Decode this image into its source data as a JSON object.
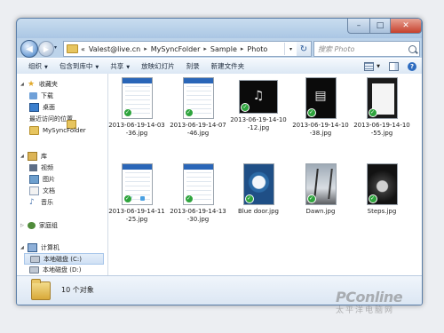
{
  "window": {
    "controls": {
      "min": "–",
      "max": "□",
      "close": "✕"
    }
  },
  "address": {
    "recent_arrow": "▾",
    "lead": "«",
    "crumbs": [
      "Valest@live.cn",
      "MySyncFolder",
      "Sample",
      "Photo"
    ],
    "separator": "▸",
    "dropdown": "▾",
    "refresh": "↻"
  },
  "search": {
    "placeholder": "搜索 Photo"
  },
  "toolbar": {
    "organize": "组织",
    "include": "包含到库中",
    "share": "共享",
    "slideshow": "放映幻灯片",
    "burn": "刻录",
    "new_folder": "新建文件夹",
    "help": "?"
  },
  "sidebar": {
    "favorites": "收藏夹",
    "downloads": "下载",
    "desktop": "桌面",
    "recent": "最近访问的位置",
    "mysync": "MySyncFolder",
    "libraries": "库",
    "videos": "视频",
    "pictures": "图片",
    "documents": "文档",
    "music": "音乐",
    "homegroup": "家庭组",
    "computer": "计算机",
    "drive_c": "本地磁盘 (C:)",
    "drive_d": "本地磁盘 (D:)"
  },
  "files": [
    "2013-06-19-14-03-36.jpg",
    "2013-06-19-14-07-46.jpg",
    "2013-06-19-14-10-12.jpg",
    "2013-06-19-14-10-38.jpg",
    "2013-06-19-14-10-55.jpg",
    "2013-06-19-14-11-25.jpg",
    "2013-06-19-14-13-30.jpg",
    "Blue door.jpg",
    "Dawn.jpg",
    "Steps.jpg"
  ],
  "status": {
    "count": "10 个对象"
  },
  "watermark": {
    "brand": "PConline",
    "sub": "太平洋电脑网"
  },
  "colors": {
    "sync_check": "#2ea43d",
    "accent": "#2a66b8"
  }
}
